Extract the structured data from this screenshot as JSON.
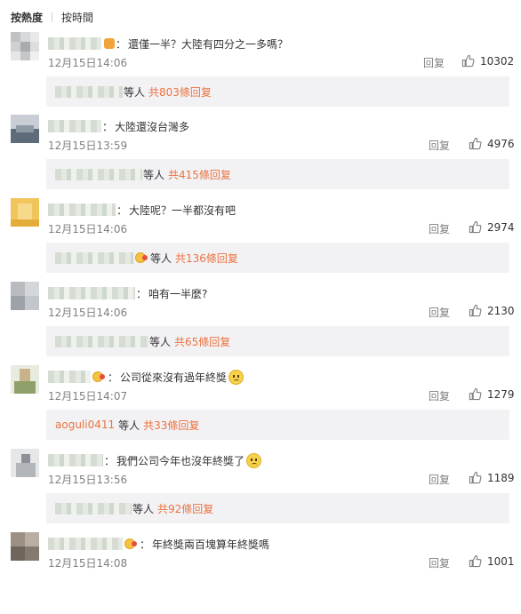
{
  "sort": {
    "active": "按熱度",
    "other": "按時間"
  },
  "comments": [
    {
      "text": "還僅一半？大陸有四分之一多嗎？",
      "time": "12月15日14:06",
      "reply": "回复",
      "likes": "10302",
      "sub_count": "共803條回复",
      "sub_and": "等人",
      "sub_user": ""
    },
    {
      "text": "大陸還沒台灣多",
      "time": "12月15日13:59",
      "reply": "回复",
      "likes": "4976",
      "sub_count": "共415條回复",
      "sub_and": "等人",
      "sub_user": ""
    },
    {
      "text": "大陸呢？一半都沒有吧",
      "time": "12月15日14:06",
      "reply": "回复",
      "likes": "2974",
      "sub_count": "共136條回复",
      "sub_and": "等人",
      "sub_user": ""
    },
    {
      "text": "咱有一半麼?",
      "time": "12月15日14:06",
      "reply": "回复",
      "likes": "2130",
      "sub_count": "共65條回复",
      "sub_and": "等人",
      "sub_user": ""
    },
    {
      "text": "公司從來沒有過年終獎",
      "time": "12月15日14:07",
      "reply": "回复",
      "likes": "1279",
      "sub_count": "共33條回复",
      "sub_and": "等人",
      "sub_user": "aoguli0411"
    },
    {
      "text": "我們公司今年也沒年終獎了",
      "time": "12月15日13:56",
      "reply": "回复",
      "likes": "1189",
      "sub_count": "共92條回复",
      "sub_and": "等人",
      "sub_user": ""
    },
    {
      "text": "年終獎兩百塊算年終獎嗎",
      "time": "12月15日14:08",
      "reply": "回复",
      "likes": "1001"
    }
  ],
  "colon": "：",
  "icons": {
    "like": "thumbs-up-icon",
    "badge": "vip-badge-icon",
    "emoji": "emoji-icon"
  },
  "colors": {
    "accent": "#eb7340",
    "meta": "#808080",
    "sub_bg": "#f2f2f5"
  }
}
